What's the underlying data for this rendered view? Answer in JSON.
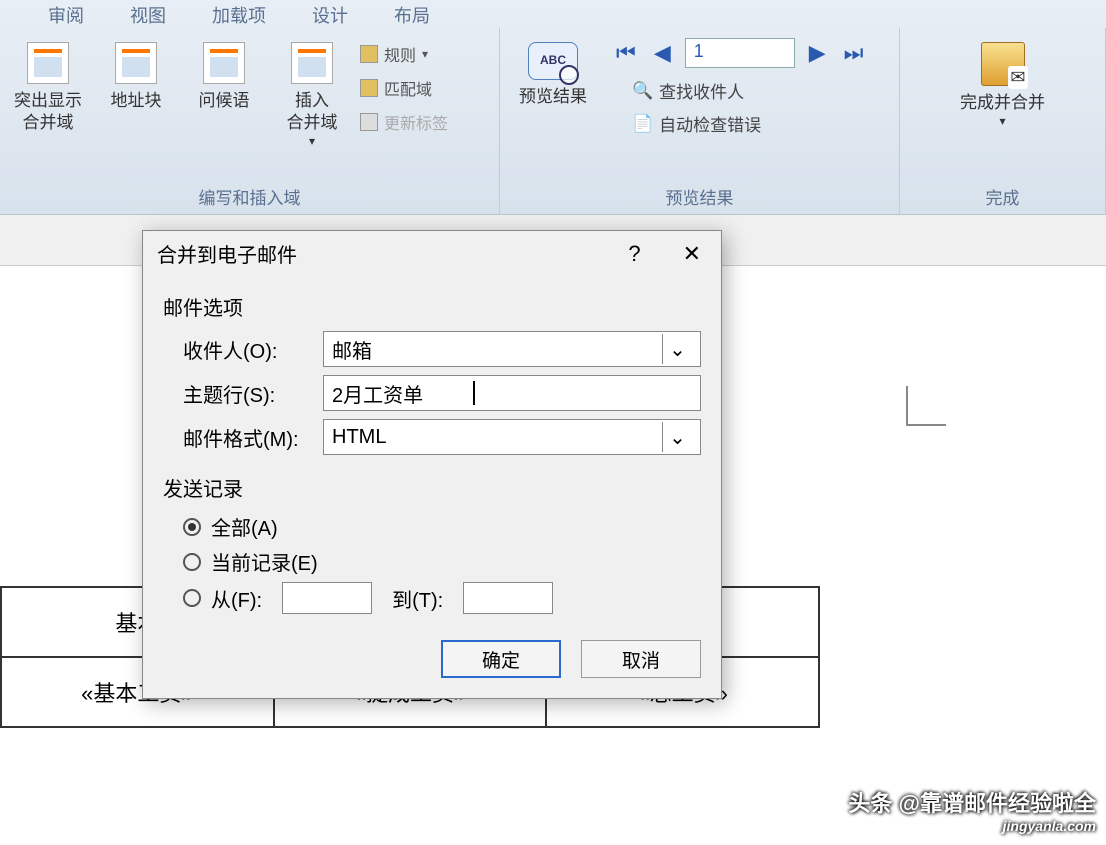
{
  "tabs": [
    "审阅",
    "视图",
    "加载项",
    "设计",
    "布局"
  ],
  "ribbon": {
    "group1": {
      "btn1": "突出显示\n合并域",
      "btn2": "地址块",
      "btn3": "问候语",
      "btn4": "插入\n合并域",
      "side": {
        "rules": "规则",
        "match": "匹配域",
        "update": "更新标签"
      },
      "label": "编写和插入域"
    },
    "group2": {
      "btn": "预览结果",
      "record": "1",
      "side": {
        "find": "查找收件人",
        "check": "自动检查错误"
      },
      "label": "预览结果"
    },
    "group3": {
      "btn": "完成并合并",
      "label": "完成"
    }
  },
  "dialog": {
    "title": "合并到电子邮件",
    "section_mail": "邮件选项",
    "recipient_label": "收件人(O):",
    "recipient_value": "邮箱",
    "subject_label": "主题行(S):",
    "subject_value": "2月工资单",
    "format_label": "邮件格式(M):",
    "format_value": "HTML",
    "section_send": "发送记录",
    "opt_all": "全部(A)",
    "opt_current": "当前记录(E)",
    "opt_from": "从(F):",
    "opt_to": "到(T):",
    "ok": "确定",
    "cancel": "取消"
  },
  "table": {
    "h1": "基本",
    "c1": "«基本工资»",
    "c2": "«提成工资»",
    "c3": "«总工资»"
  },
  "watermark": {
    "text": "头条 @靠谱邮件经验啦全",
    "site": "jingyanla.com"
  }
}
